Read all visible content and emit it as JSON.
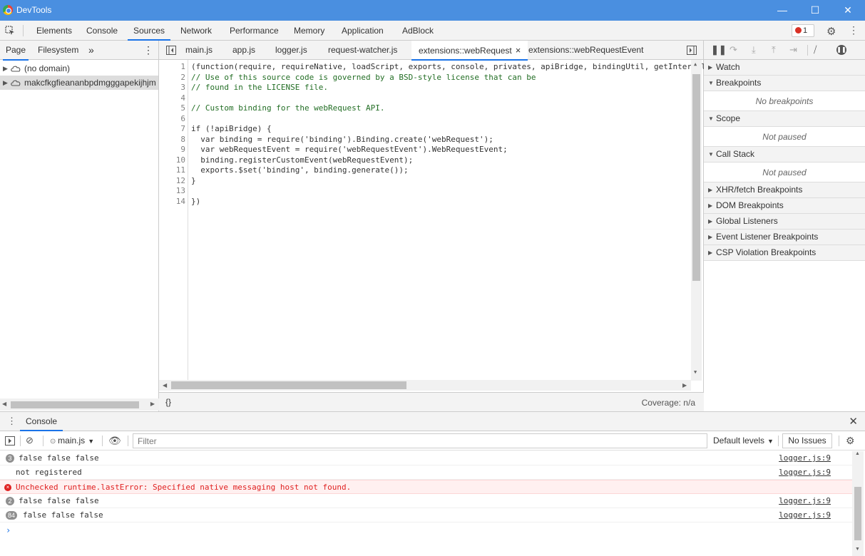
{
  "window": {
    "title": "DevTools",
    "minimize": "—",
    "maximize": "☐",
    "close": "✕"
  },
  "main_tabs": [
    "Elements",
    "Console",
    "Sources",
    "Network",
    "Performance",
    "Memory",
    "Application",
    "AdBlock"
  ],
  "error_count": "1",
  "navigator": {
    "tabs": [
      "Page",
      "Filesystem"
    ],
    "more": "»",
    "items": [
      "(no domain)",
      "makcfkgfieananbpdmgggapekijhjm"
    ]
  },
  "editor": {
    "tabs": [
      "main.js",
      "app.js",
      "logger.js",
      "request-watcher.js",
      "extensions::webRequest",
      "extensions::webRequestEvent"
    ],
    "active_tab_close": "×",
    "line_numbers": [
      "1",
      "2",
      "3",
      "4",
      "5",
      "6",
      "7",
      "8",
      "9",
      "10",
      "11",
      "12",
      "13",
      "14"
    ],
    "lines": [
      "(function(require, requireNative, loadScript, exports, console, privates, apiBridge, bindingUtil, getInternalApi, $Array, $Function, $JSON",
      "// Use of this source code is governed by a BSD-style license that can be",
      "// found in the LICENSE file.",
      "",
      "// Custom binding for the webRequest API.",
      "",
      "if (!apiBridge) {",
      "  var binding = require('binding').Binding.create('webRequest');",
      "  var webRequestEvent = require('webRequestEvent').WebRequestEvent;",
      "  binding.registerCustomEvent(webRequestEvent);",
      "  exports.$set('binding', binding.generate());",
      "}",
      "",
      "})"
    ],
    "pretty_print": "{}",
    "coverage": "Coverage: n/a"
  },
  "debugger": {
    "panes": [
      {
        "title": "Watch",
        "expanded": false,
        "body": ""
      },
      {
        "title": "Breakpoints",
        "expanded": true,
        "body": "No breakpoints"
      },
      {
        "title": "Scope",
        "expanded": true,
        "body": "Not paused"
      },
      {
        "title": "Call Stack",
        "expanded": true,
        "body": "Not paused"
      },
      {
        "title": "XHR/fetch Breakpoints",
        "expanded": false,
        "body": ""
      },
      {
        "title": "DOM Breakpoints",
        "expanded": false,
        "body": ""
      },
      {
        "title": "Global Listeners",
        "expanded": false,
        "body": ""
      },
      {
        "title": "Event Listener Breakpoints",
        "expanded": false,
        "body": ""
      },
      {
        "title": "CSP Violation Breakpoints",
        "expanded": false,
        "body": ""
      }
    ]
  },
  "console": {
    "drawer_tab": "Console",
    "context": "main.js",
    "filter_placeholder": "Filter",
    "levels": "Default levels",
    "issues": "No Issues",
    "messages": [
      {
        "type": "log",
        "count": "3",
        "text": "false false false",
        "source": "logger.js:9"
      },
      {
        "type": "log",
        "count": "",
        "text": "not registered",
        "source": "logger.js:9"
      },
      {
        "type": "error",
        "count": "",
        "text": "Unchecked runtime.lastError: Specified native messaging host not found.",
        "source": ""
      },
      {
        "type": "log",
        "count": "2",
        "text": "false false false",
        "source": "logger.js:9"
      },
      {
        "type": "log",
        "count": "84",
        "text": "false false false",
        "source": "logger.js:9"
      }
    ],
    "prompt": "›"
  }
}
